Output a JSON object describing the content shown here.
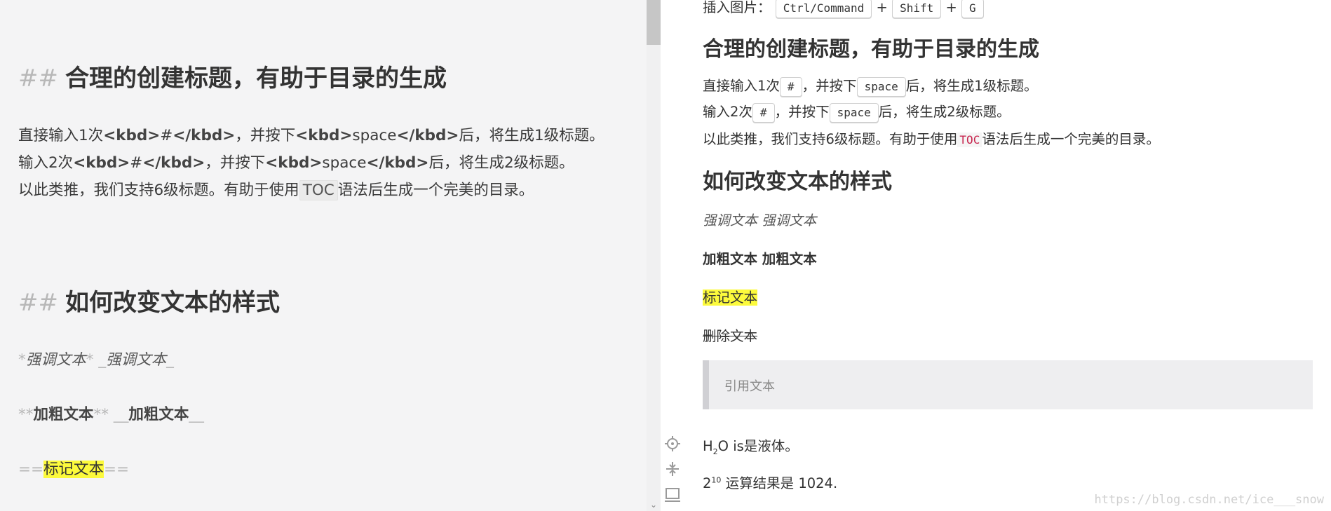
{
  "editor": {
    "h2_toc": {
      "marker": "##",
      "text": "合理的创建标题，有助于目录的生成"
    },
    "line1": {
      "a": "直接输入1次",
      "kbd_open": "<kbd>",
      "hash": "#",
      "kbd_close": "</kbd>",
      "b": "，并按下",
      "space": "space",
      "c": "后，将生成1级标题。"
    },
    "line2": {
      "a": "输入2次",
      "kbd_open": "<kbd>",
      "hash": "#",
      "kbd_close": "</kbd>",
      "b": "，并按下",
      "space": "space",
      "c": "后，将生成2级标题。"
    },
    "line3": {
      "a": "以此类推，我们支持6级标题。有助于使用",
      "toc": "TOC",
      "c": "语法后生成一个完美的目录。"
    },
    "h2_style": {
      "marker": "##",
      "text": "如何改变文本的样式"
    },
    "emph": {
      "m1": "*",
      "t1": "强调文本",
      "m2": "*",
      "m3": "_",
      "t2": "强调文本",
      "m4": "_"
    },
    "bold": {
      "m1": "**",
      "t1": "加粗文本",
      "m2": "**",
      "m3": "__",
      "t2": "加粗文本",
      "m4": "__"
    },
    "mark": {
      "m1": "==",
      "t1": "标记文本",
      "m2": "=="
    }
  },
  "preview": {
    "top": {
      "label": "插入图片：",
      "k1": "Ctrl/Command",
      "plus1": "+",
      "k2": "Shift",
      "plus2": "+",
      "k3": "G"
    },
    "h2_toc": "合理的创建标题，有助于目录的生成",
    "p1": {
      "a": "直接输入1次",
      "k": "#",
      "b": "，并按下",
      "s": "space",
      "c": "后，将生成1级标题。"
    },
    "p2": {
      "a": "输入2次",
      "k": "#",
      "b": "，并按下",
      "s": "space",
      "c": "后，将生成2级标题。"
    },
    "p3": {
      "a": "以此类推，我们支持6级标题。有助于使用",
      "toc": "TOC",
      "c": "语法后生成一个完美的目录。"
    },
    "h2_style": "如何改变文本的样式",
    "emph": "强调文本 强调文本",
    "bold": "加粗文本 加粗文本",
    "mark": "标记文本",
    "del": "删除文本",
    "quote": "引用文本",
    "sub_line": {
      "a": "H",
      "sub": "2",
      "b": "O is是液体。"
    },
    "sup_line": {
      "a": "2",
      "sup": "10",
      "b": " 运算结果是 1024."
    },
    "watermark": "https://blog.csdn.net/ice___snow"
  },
  "icons": [
    "locate-icon",
    "expand-icon",
    "preview-toggle-icon",
    "chevron-down-icon"
  ]
}
